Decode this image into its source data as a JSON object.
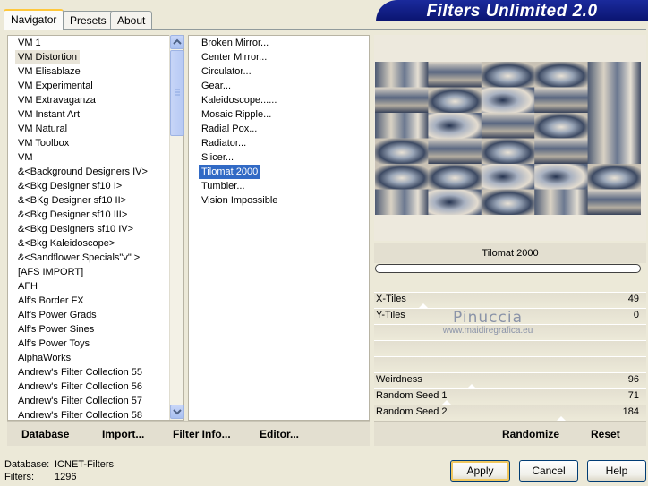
{
  "tabs": [
    "Navigator",
    "Presets",
    "About"
  ],
  "banner": "Filters Unlimited 2.0",
  "categories": [
    "VM 1",
    "VM Distortion",
    "VM Elisablaze",
    "VM Experimental",
    "VM Extravaganza",
    "VM Instant Art",
    "VM Natural",
    "VM Toolbox",
    "VM",
    "&<Background Designers IV>",
    "&<Bkg Designer sf10 I>",
    "&<BKg Designer sf10 II>",
    "&<Bkg Designer sf10 III>",
    "&<Bkg Designers sf10 IV>",
    "&<Bkg Kaleidoscope>",
    "&<Sandflower Specials\"v\" >",
    "[AFS IMPORT]",
    "AFH",
    "Alf's Border FX",
    "Alf's Power Grads",
    "Alf's Power Sines",
    "Alf's Power Toys",
    "AlphaWorks",
    "Andrew's Filter Collection 55",
    "Andrew's Filter Collection 56",
    "Andrew's Filter Collection 57",
    "Andrew's Filter Collection 58"
  ],
  "selected_category": "VM Distortion",
  "filters": [
    "Broken Mirror...",
    "Center Mirror...",
    "Circulator...",
    "Gear...",
    "Kaleidoscope......",
    "Mosaic Ripple...",
    "Radial Pox...",
    "Radiator...",
    "Slicer...",
    "Tilomat 2000",
    "Tumbler...",
    "Vision Impossible"
  ],
  "selected_filter": "Tilomat 2000",
  "left_buttons": {
    "database": "Database",
    "import": "Import...",
    "filter_info": "Filter Info...",
    "editor": "Editor..."
  },
  "right_buttons": {
    "randomize": "Randomize",
    "reset": "Reset"
  },
  "preview_title": "Tilomat 2000",
  "params": [
    {
      "label": "X-Tiles",
      "value": "49",
      "level": 0.19
    },
    {
      "label": "Y-Tiles",
      "value": "0",
      "level": 0.0
    },
    {
      "label": "",
      "value": "",
      "level": null
    },
    {
      "label": "",
      "value": "",
      "level": null
    },
    {
      "label": "",
      "value": "",
      "level": null
    },
    {
      "label": "Weirdness",
      "value": "96",
      "level": 0.376
    },
    {
      "label": "Random Seed 1",
      "value": "71",
      "level": 0.278
    },
    {
      "label": "Random Seed 2",
      "value": "184",
      "level": 0.722
    }
  ],
  "watermark": {
    "name": "Pinuccia",
    "url": "www.maidiregrafica.eu"
  },
  "status": {
    "db_label": "Database:",
    "db_value": "ICNET-Filters",
    "filters_label": "Filters:",
    "filters_value": "1296"
  },
  "dialog_buttons": {
    "apply": "Apply",
    "cancel": "Cancel",
    "help": "Help"
  },
  "colors": {
    "selection": "#316ac5",
    "banner": "#0e1a7c",
    "tab_accent": "#ffc83c"
  }
}
